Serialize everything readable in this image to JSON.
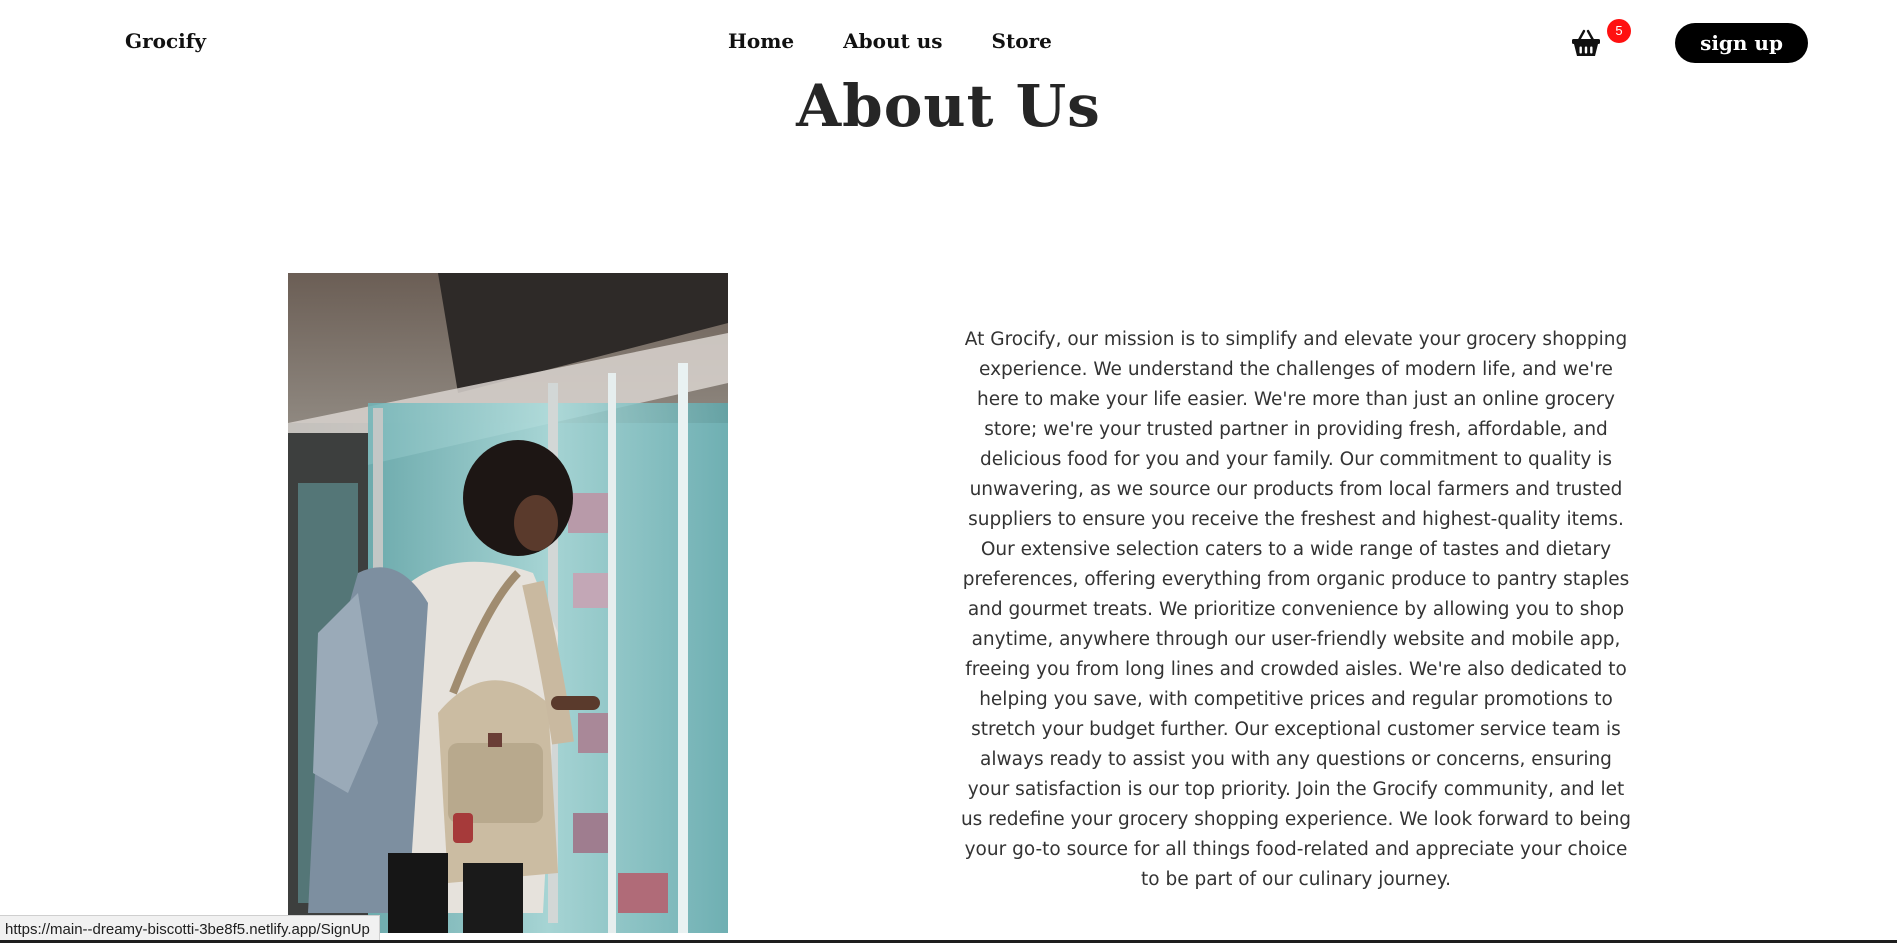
{
  "navbar": {
    "brand": "Grocify",
    "links": [
      "Home",
      "About us",
      "Store"
    ],
    "cart_icon": "basket-icon",
    "cart_count": "5",
    "signup_label": "sign up"
  },
  "main": {
    "title": "About Us",
    "photo_icon": "shopper-photo",
    "paragraph": "At Grocify, our mission is to simplify and elevate your grocery shopping experience. We understand the challenges of modern life, and we're here to make your life easier. We're more than just an online grocery store; we're your trusted partner in providing fresh, affordable, and delicious food for you and your family. Our commitment to quality is unwavering, as we source our products from local farmers and trusted suppliers to ensure you receive the freshest and highest-quality items. Our extensive selection caters to a wide range of tastes and dietary preferences, offering everything from organic produce to pantry staples and gourmet treats. We prioritize convenience by allowing you to shop anytime, anywhere through our user-friendly website and mobile app, freeing you from long lines and crowded aisles. We're also dedicated to helping you save, with competitive prices and regular promotions to stretch your budget further. Our exceptional customer service team is always ready to assist you with any questions or concerns, ensuring your satisfaction is our top priority. Join the Grocify community, and let us redefine your grocery shopping experience. We look forward to being your go-to source for all things food-related and appreciate your choice to be part of our culinary journey."
  },
  "status_bar": {
    "url": "https://main--dreamy-biscotti-3be8f5.netlify.app/SignUp"
  },
  "colors": {
    "badge": "#ff1010",
    "button": "#000000",
    "text": "#333333"
  }
}
